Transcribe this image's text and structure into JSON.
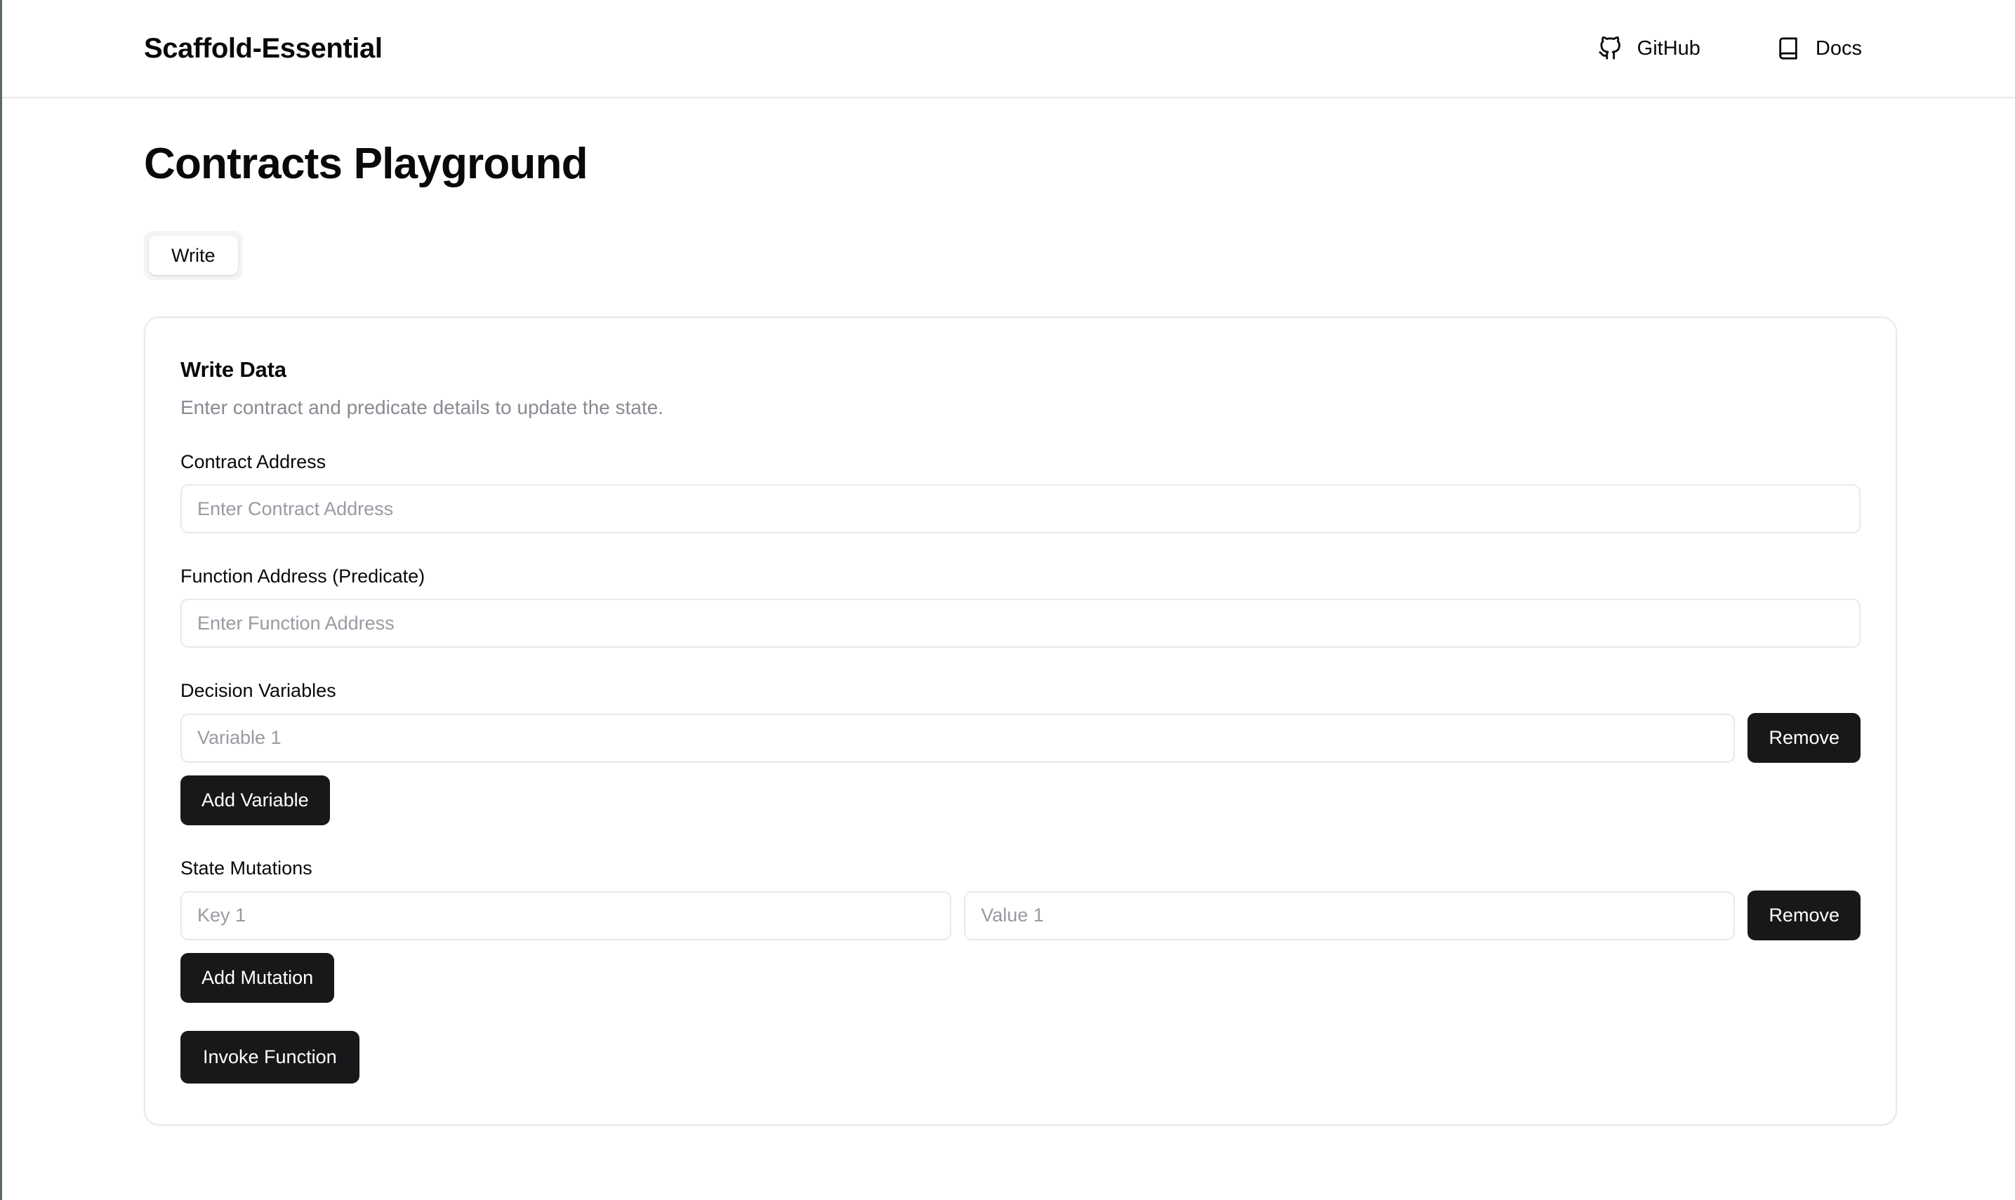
{
  "header": {
    "brand": "Scaffold-Essential",
    "nav": [
      {
        "label": "GitHub",
        "icon": "github-icon"
      },
      {
        "label": "Docs",
        "icon": "book-icon"
      }
    ]
  },
  "page": {
    "title": "Contracts Playground"
  },
  "tabs": [
    {
      "label": "Write",
      "active": true
    }
  ],
  "card": {
    "title": "Write Data",
    "description": "Enter contract and predicate details to update the state.",
    "fields": {
      "contract_address": {
        "label": "Contract Address",
        "placeholder": "Enter Contract Address",
        "value": ""
      },
      "function_address": {
        "label": "Function Address (Predicate)",
        "placeholder": "Enter Function Address",
        "value": ""
      },
      "decision_variables": {
        "label": "Decision Variables",
        "rows": [
          {
            "placeholder": "Variable 1",
            "value": "",
            "remove_label": "Remove"
          }
        ],
        "add_label": "Add Variable"
      },
      "state_mutations": {
        "label": "State Mutations",
        "rows": [
          {
            "key_placeholder": "Key 1",
            "key_value": "",
            "value_placeholder": "Value 1",
            "value_value": "",
            "remove_label": "Remove"
          }
        ],
        "add_label": "Add Mutation"
      }
    },
    "submit_label": "Invoke Function"
  },
  "colors": {
    "button_dark": "#18181b",
    "border": "#e9e9eb",
    "muted_text": "#8a8a93",
    "tab_track": "#f4f4f5"
  }
}
